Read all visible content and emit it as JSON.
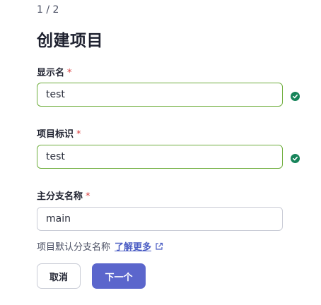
{
  "wizard": {
    "step": "1 / 2",
    "title": "创建项目"
  },
  "fields": {
    "display_name": {
      "label": "显示名",
      "required_mark": "*",
      "value": "test",
      "status": "valid",
      "status_icon": "check-circle-icon"
    },
    "project_id": {
      "label": "项目标识",
      "required_mark": "*",
      "value": "test",
      "status": "valid",
      "status_icon": "check-circle-icon"
    },
    "main_branch": {
      "label": "主分支名称",
      "required_mark": "*",
      "value": "main",
      "hint": "项目默认分支名称",
      "hint_link": "了解更多",
      "hint_link_icon": "external-link-icon"
    }
  },
  "actions": {
    "cancel_label": "取消",
    "next_label": "下一个"
  },
  "colors": {
    "valid_border": "#6fae3d",
    "valid_icon": "#17845a",
    "required": "#d93f3f",
    "primary": "#5b66cc",
    "link": "#4c5ec4"
  }
}
